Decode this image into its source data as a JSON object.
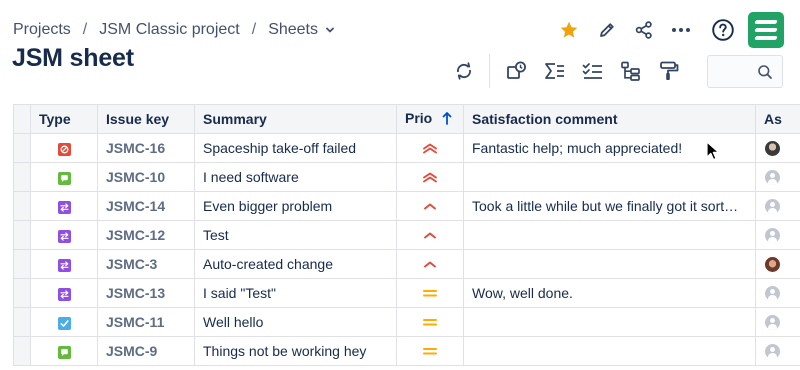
{
  "breadcrumb": {
    "items": [
      "Projects",
      "JSM Classic project",
      "Sheets"
    ],
    "separator": "/"
  },
  "page": {
    "title": "JSM sheet"
  },
  "top_actions": [
    "star-icon",
    "edit-icon",
    "share-icon",
    "more-icon",
    "help-icon"
  ],
  "toolbar": {
    "buttons": [
      "refresh-icon",
      "shapes-icon",
      "sum-icon",
      "checklist-icon",
      "hierarchy-icon",
      "paint-roller-icon"
    ],
    "search": {
      "value": "",
      "placeholder": ""
    }
  },
  "colors": {
    "star": "#f2a30b",
    "logo": "#21a366",
    "type_bug": "#e5493a",
    "type_service": "#63ba3c",
    "type_change": "#904ee2",
    "type_task": "#4bade8",
    "prio_high": "#e5493a",
    "prio_medium": "#ffab00",
    "sort_arrow": "#0052cc"
  },
  "table": {
    "columns": [
      "Type",
      "Issue key",
      "Summary",
      "Prio",
      "Satisfaction comment",
      "As"
    ],
    "sort": {
      "column": "Prio",
      "direction": "ascending"
    },
    "rows": [
      {
        "type": "bug",
        "key": "JSMC-16",
        "summary": "Spaceship take-off failed",
        "priority": "highest",
        "comment": "Fantastic help; much appreciated!",
        "assignee": "photo-1"
      },
      {
        "type": "service-request",
        "key": "JSMC-10",
        "summary": "I need software",
        "priority": "highest",
        "comment": "",
        "assignee": "unassigned"
      },
      {
        "type": "change",
        "key": "JSMC-14",
        "summary": "Even bigger problem",
        "priority": "high",
        "comment": "Took a little while but we finally got it sort…",
        "assignee": "unassigned"
      },
      {
        "type": "change",
        "key": "JSMC-12",
        "summary": "Test",
        "priority": "high",
        "comment": "",
        "assignee": "unassigned"
      },
      {
        "type": "change",
        "key": "JSMC-3",
        "summary": "Auto-created change",
        "priority": "high",
        "comment": "",
        "assignee": "photo-2"
      },
      {
        "type": "change",
        "key": "JSMC-13",
        "summary": "I said \"Test\"",
        "priority": "medium",
        "comment": "Wow, well done.",
        "assignee": "unassigned"
      },
      {
        "type": "task",
        "key": "JSMC-11",
        "summary": "Well hello",
        "priority": "medium",
        "comment": "",
        "assignee": "unassigned"
      },
      {
        "type": "service-request",
        "key": "JSMC-9",
        "summary": "Things not be working hey",
        "priority": "medium",
        "comment": "",
        "assignee": "unassigned"
      }
    ]
  }
}
